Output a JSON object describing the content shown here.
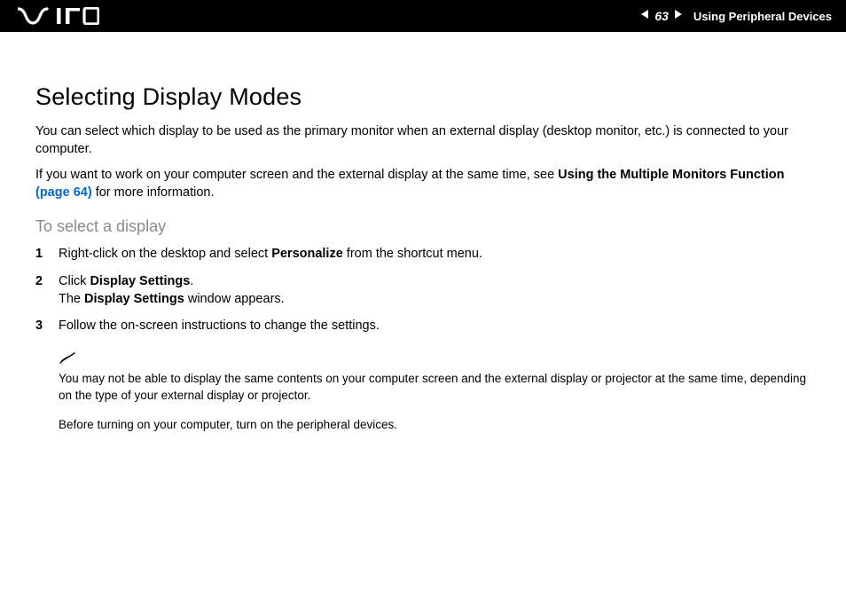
{
  "header": {
    "page_number": "63",
    "section_label": "Using Peripheral Devices"
  },
  "main": {
    "title": "Selecting Display Modes",
    "intro1": "You can select which display to be used as the primary monitor when an external display (desktop monitor, etc.) is connected to your computer.",
    "intro2_pre": "If you want to work on your computer screen and the external display at the same time, see ",
    "intro2_bold": "Using the Multiple Monitors Function",
    "intro2_link": " (page 64)",
    "intro2_post": " for more information.",
    "subheading": "To select a display",
    "steps": [
      {
        "num": "1",
        "pre": "Right-click on the desktop and select ",
        "bold": "Personalize",
        "post": " from the shortcut menu."
      },
      {
        "num": "2",
        "line1_pre": "Click ",
        "line1_bold": "Display Settings",
        "line1_post": ".",
        "line2_pre": "The ",
        "line2_bold": "Display Settings",
        "line2_post": " window appears."
      },
      {
        "num": "3",
        "text": "Follow the on-screen instructions to change the settings."
      }
    ],
    "note1": "You may not be able to display the same contents on your computer screen and the external display or projector at the same time, depending on the type of your external display or projector.",
    "note2": "Before turning on your computer, turn on the peripheral devices."
  }
}
